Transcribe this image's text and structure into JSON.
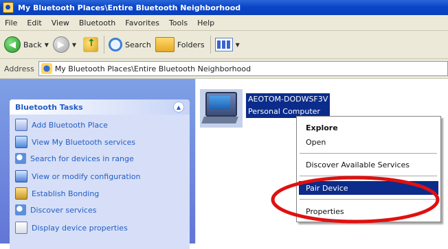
{
  "window": {
    "title": "My Bluetooth Places\\Entire Bluetooth Neighborhood"
  },
  "menu": [
    "File",
    "Edit",
    "View",
    "Bluetooth",
    "Favorites",
    "Tools",
    "Help"
  ],
  "toolbar": {
    "back_label": "Back",
    "search_label": "Search",
    "folders_label": "Folders"
  },
  "address": {
    "label": "Address",
    "path": "My Bluetooth Places\\Entire Bluetooth Neighborhood"
  },
  "tasks": {
    "header": "Bluetooth Tasks",
    "items": [
      {
        "label": "Add Bluetooth Place",
        "icon": "add-place-icon"
      },
      {
        "label": "View My Bluetooth services",
        "icon": "services-icon"
      },
      {
        "label": "Search for devices in range",
        "icon": "search-icon"
      },
      {
        "label": "View or modify configuration",
        "icon": "configuration-icon"
      },
      {
        "label": "Establish Bonding",
        "icon": "bonding-icon"
      },
      {
        "label": "Discover services",
        "icon": "discover-icon"
      },
      {
        "label": "Display device properties",
        "icon": "properties-icon"
      }
    ]
  },
  "device": {
    "name": "AEOTOM-DODWSF3V",
    "type": "Personal Computer"
  },
  "context_menu": {
    "explore": "Explore",
    "open": "Open",
    "discover": "Discover Available Services",
    "pair": "Pair Device",
    "properties": "Properties"
  },
  "colors": {
    "highlight": "#0b2c8a",
    "annotation": "#e01010",
    "task_link": "#215dc6"
  }
}
